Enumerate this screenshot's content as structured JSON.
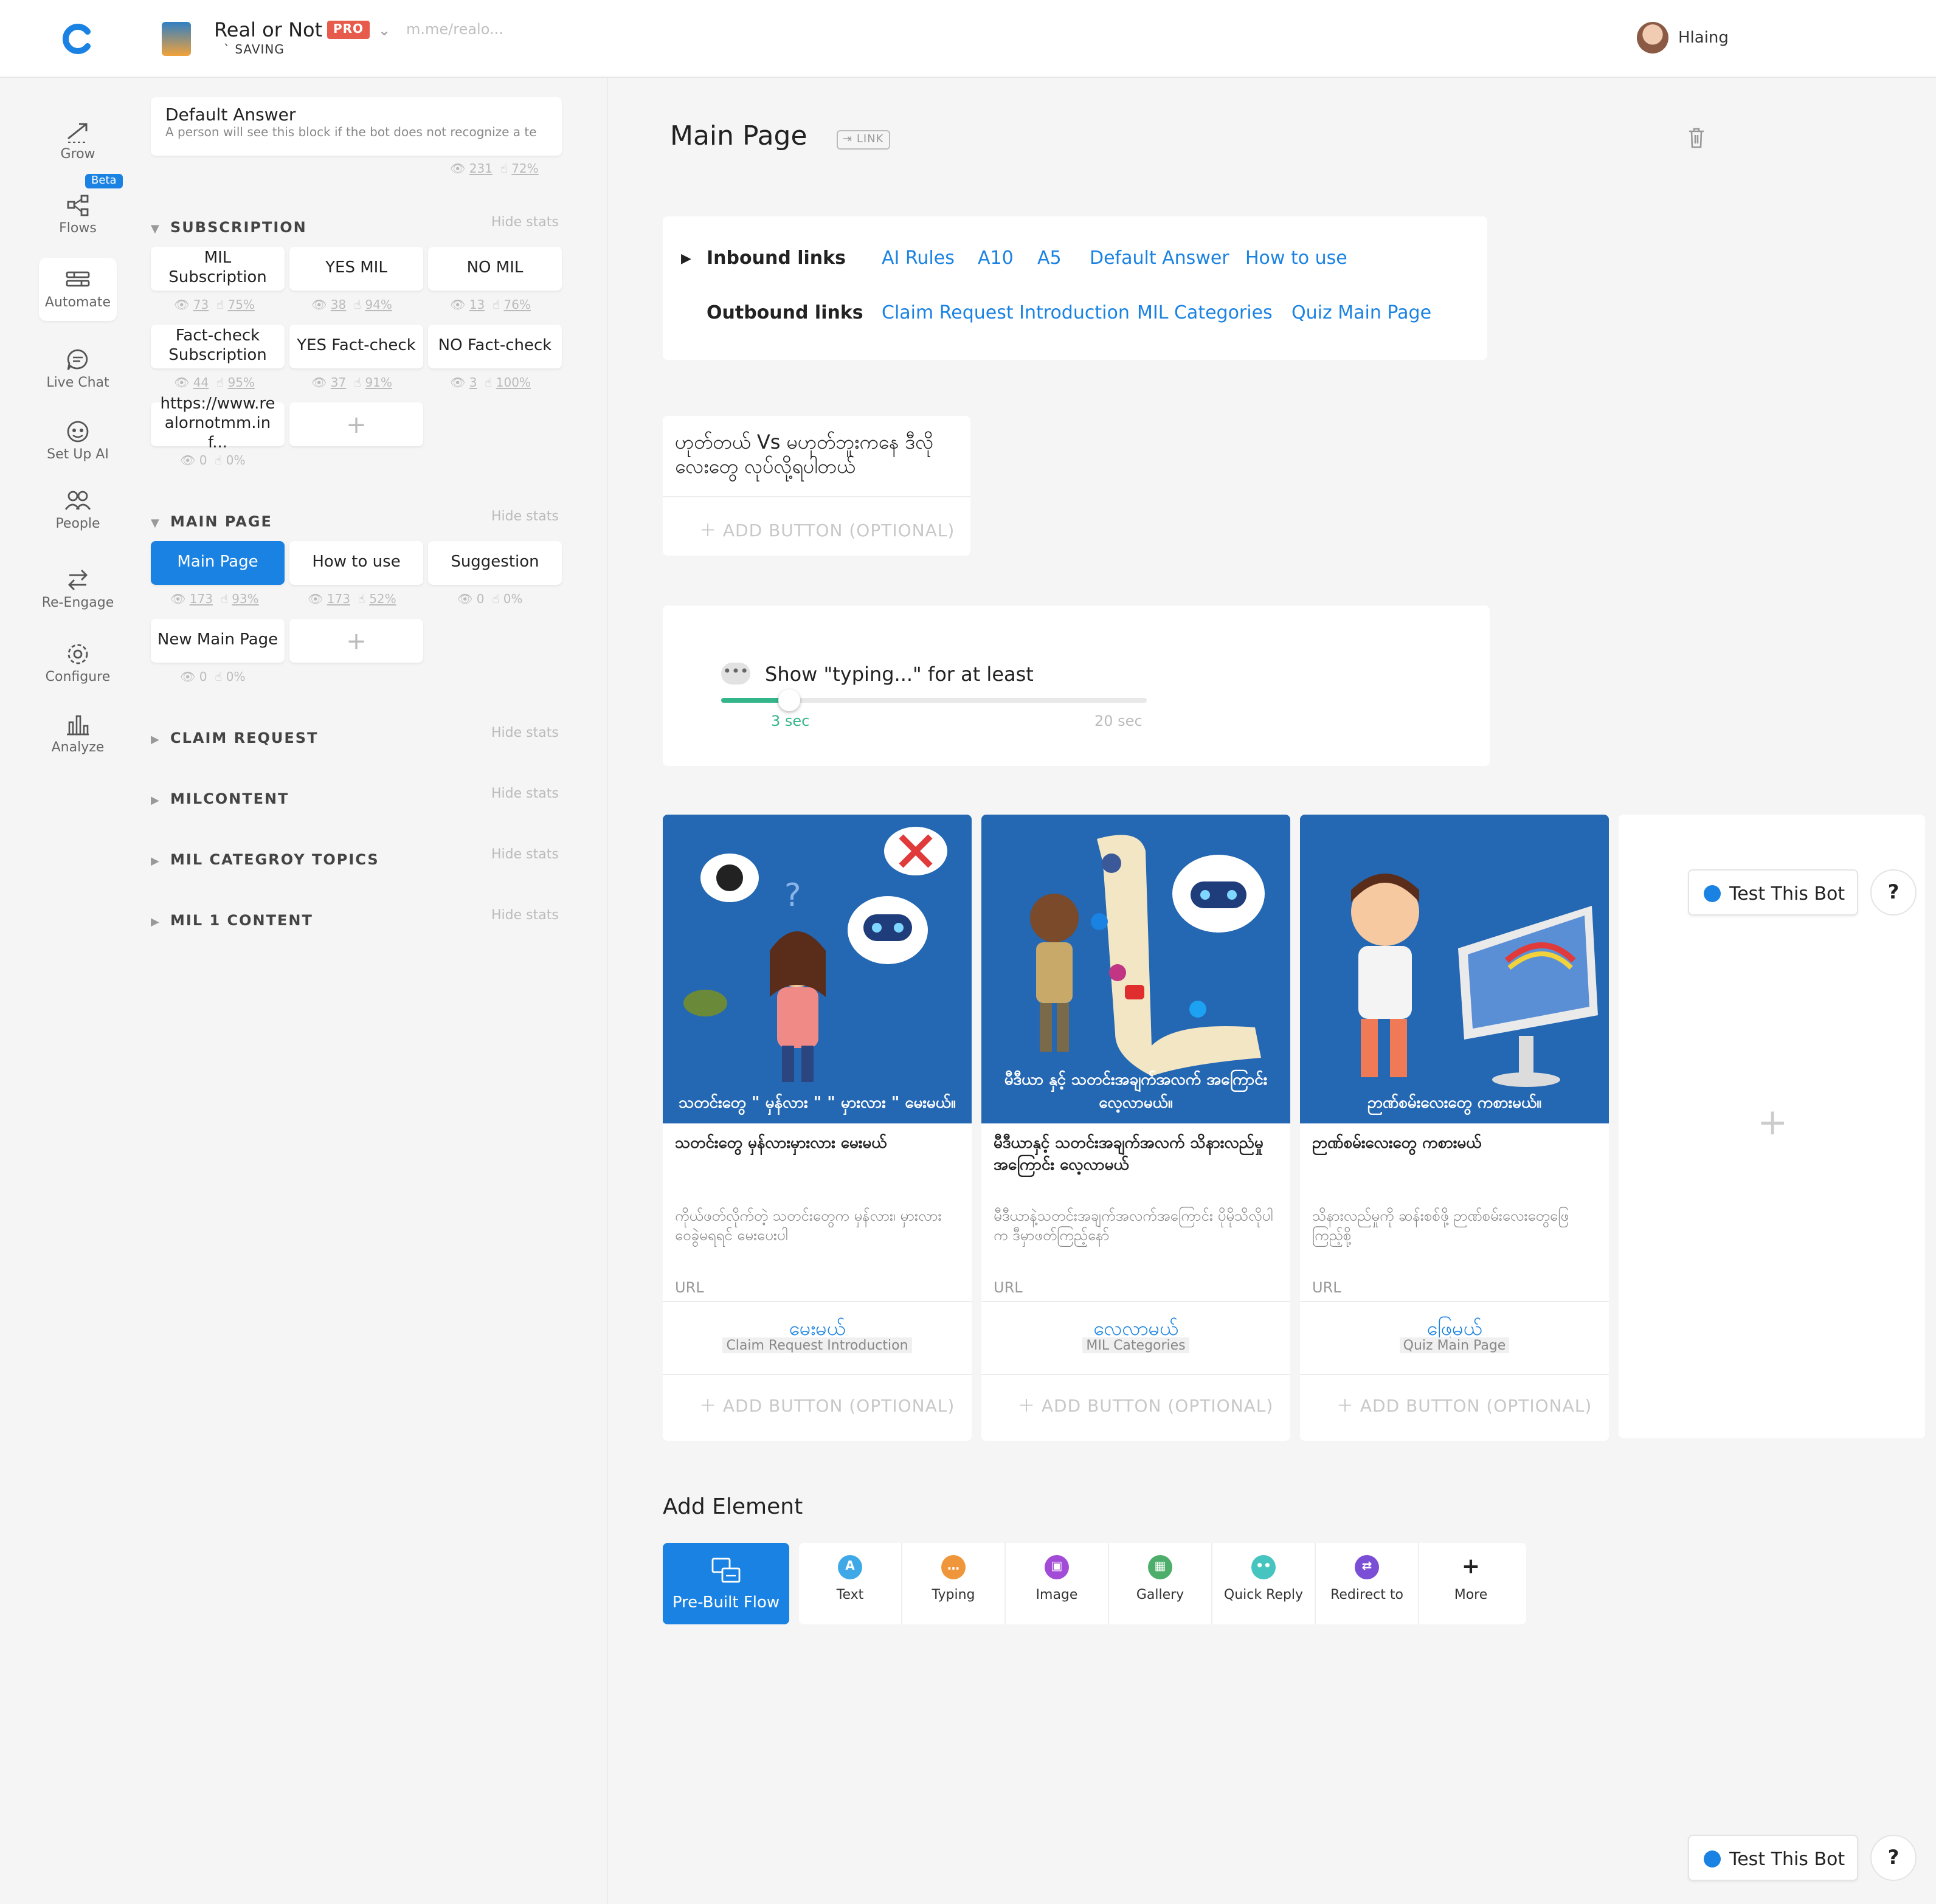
{
  "header": {
    "bot_name": "Real or Not",
    "pro_badge": "PRO",
    "bot_url": "m.me/realo...",
    "saving_status": "` SAVING",
    "user_name": "Hlaing"
  },
  "leftnav": {
    "items": [
      {
        "label": "Grow",
        "icon": "grow-icon"
      },
      {
        "label": "Flows",
        "icon": "flows-icon"
      },
      {
        "label": "Automate",
        "icon": "automate-icon"
      },
      {
        "label": "Live Chat",
        "icon": "chat-icon"
      },
      {
        "label": "Set Up AI",
        "icon": "ai-icon"
      },
      {
        "label": "People",
        "icon": "people-icon"
      },
      {
        "label": "Re-Engage",
        "icon": "reengage-icon"
      },
      {
        "label": "Configure",
        "icon": "gear-icon"
      },
      {
        "label": "Analyze",
        "icon": "analyze-icon"
      }
    ],
    "beta_badge": "Beta"
  },
  "blocks": {
    "default_answer": {
      "title": "Default Answer",
      "subtitle": "A person will see this block if the bot does not recognize a te",
      "views": "231",
      "clicks": "72%"
    },
    "subscription": {
      "title": "SUBSCRIPTION",
      "hide_stats": "Hide stats",
      "items": [
        {
          "label": "MIL Subscription",
          "views": "73",
          "clicks": "75%"
        },
        {
          "label": "YES MIL",
          "views": "38",
          "clicks": "94%"
        },
        {
          "label": "NO MIL",
          "views": "13",
          "clicks": "76%"
        },
        {
          "label": "Fact-check Subscription",
          "views": "44",
          "clicks": "95%"
        },
        {
          "label": "YES Fact-check",
          "views": "37",
          "clicks": "91%"
        },
        {
          "label": "NO Fact-check",
          "views": "3",
          "clicks": "100%"
        },
        {
          "label": "https://www.realornotmm.inf...",
          "views": "0",
          "clicks": "0%"
        }
      ],
      "add": "+"
    },
    "main_page": {
      "title": "MAIN PAGE",
      "hide_stats": "Hide stats",
      "items": [
        {
          "label": "Main Page",
          "views": "173",
          "clicks": "93%"
        },
        {
          "label": "How to use",
          "views": "173",
          "clicks": "52%"
        },
        {
          "label": "Suggestion",
          "views": "0",
          "clicks": "0%"
        },
        {
          "label": "New Main Page",
          "views": "0",
          "clicks": "0%"
        }
      ],
      "add": "+"
    },
    "collapsed_sections": [
      {
        "title": "CLAIM REQUEST",
        "hide_stats": "Hide stats"
      },
      {
        "title": "MILCONTENT",
        "hide_stats": "Hide stats"
      },
      {
        "title": "MIL CATEGROY TOPICS",
        "hide_stats": "Hide stats"
      },
      {
        "title": "MIL 1 CONTENT",
        "hide_stats": "Hide stats"
      }
    ]
  },
  "main": {
    "title": "Main Page",
    "link_badge": "LINK",
    "inbound_label": "Inbound links",
    "inbound": [
      "AI Rules",
      "A10",
      "A5",
      "Default Answer",
      "How to use"
    ],
    "outbound_label": "Outbound links",
    "outbound": [
      "Claim Request Introduction",
      "MIL Categories",
      "Quiz Main Page"
    ],
    "text_block": "ဟုတ်တယ် Vs မဟုတ်ဘူးကနေ ဒီလိုလေးတွေ လုပ်လို့ရပါတယ်",
    "add_button": "ADD BUTTON (OPTIONAL)",
    "typing": {
      "label": "Show \"typing...\" for at least",
      "min": "3 sec",
      "max": "20 sec",
      "value_fraction": 0.16
    },
    "gallery": [
      {
        "image_caption": "သတင်းတွေ \" မှန်လား \" \" မှားလား \" မေးမယ်။",
        "title": "သတင်းတွေ မှန်လားမှားလား မေးမယ်",
        "subtitle": "ကိုယ်ဖတ်လိုက်တဲ့ သတင်းတွေက မှန်လား၊ မှားလား ဝေခွဲမရရင် မေးပေးပါ",
        "url_label": "URL",
        "button_label": "မေးမယ်",
        "button_target": "Claim Request Introduction"
      },
      {
        "image_caption": "မီဒီယာ နှင့် သတင်းအချက်အလက် အကြောင်း လေ့လာမယ်။",
        "title": "မီဒီယာနှင့် သတင်းအချက်အလက် သိနားလည်မှုအကြောင်း လေ့လာမယ်",
        "subtitle": "မီဒီယာနဲ့သတင်းအချက်အလက်အကြောင်း ပိုမိုသိလိုပါက ဒီမှာဖတ်ကြည့်နော်",
        "url_label": "URL",
        "button_label": "လေ့လာမယ်",
        "button_target": "MIL Categories"
      },
      {
        "image_caption": "ဉာဏ်စမ်းလေးတွေ ကစားမယ်။",
        "title": "ဉာဏ်စမ်းလေးတွေ ကစားမယ်",
        "subtitle": "သိနားလည်မှုကို ဆန်းစစ်ဖို့ ဉာဏ်စမ်းလေးတွေဖြေကြည့်စို့",
        "url_label": "URL",
        "button_label": "ဖြေမယ်",
        "button_target": "Quiz Main Page"
      }
    ],
    "gallery_add": "+",
    "add_element_title": "Add Element",
    "elements": [
      {
        "label": "Pre-Built Flow",
        "icon": "prebuilt-flow-icon"
      },
      {
        "label": "Text",
        "icon": "text-icon",
        "color": "#3fa9e8",
        "glyph": "A"
      },
      {
        "label": "Typing",
        "icon": "typing-icon",
        "color": "#f0963a",
        "glyph": "…"
      },
      {
        "label": "Image",
        "icon": "image-icon",
        "color": "#a24bd6",
        "glyph": "▣"
      },
      {
        "label": "Gallery",
        "icon": "gallery-icon",
        "color": "#4cae6a",
        "glyph": "▦"
      },
      {
        "label": "Quick Reply",
        "icon": "quick-reply-icon",
        "color": "#46c4c0",
        "glyph": "••"
      },
      {
        "label": "Redirect to",
        "icon": "redirect-icon",
        "color": "#7a4fd6",
        "glyph": "⇄"
      },
      {
        "label": "More",
        "icon": "plus-icon",
        "color": "#ffffff",
        "glyph": "+"
      }
    ]
  },
  "test_bot": {
    "label": "Test This Bot",
    "help": "?"
  },
  "colors": {
    "accent": "#1a82e2",
    "pro": "#e65b4b",
    "slider": "#35b58a",
    "gallery_bg": "#2467b3"
  }
}
